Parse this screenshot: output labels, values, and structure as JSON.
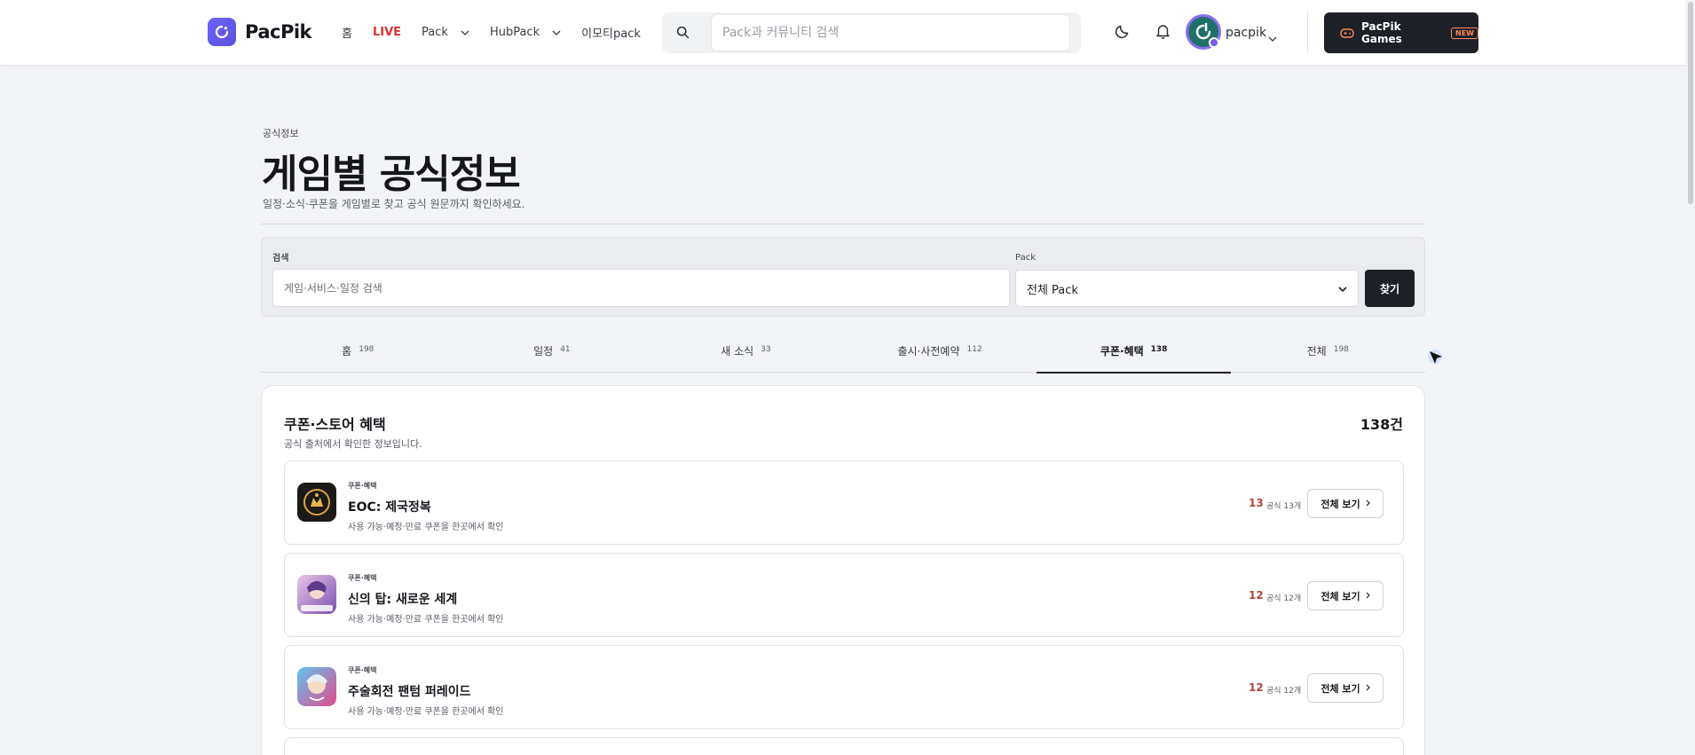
{
  "header": {
    "logo_text": "PacPik",
    "nav": [
      {
        "label": "홈"
      },
      {
        "label": "LIVE"
      },
      {
        "label": "Pack"
      },
      {
        "label": "HubPack"
      },
      {
        "label": "이모티pack"
      }
    ],
    "search_placeholder": "Pack과 커뮤니티 검색",
    "user_name": "pacpik",
    "games_button": "PacPik Games",
    "new_badge": "NEW"
  },
  "page": {
    "eyebrow": "공식정보",
    "title": "게임별 공식정보",
    "subtitle": "일정·소식·쿠폰을 게임별로 찾고 공식 원문까지 확인하세요."
  },
  "filter": {
    "search_label": "검색",
    "search_placeholder": "게임·서비스·일정 검색",
    "pack_label": "Pack",
    "pack_selected": "전체 Pack",
    "submit_label": "찾기"
  },
  "tabs": [
    {
      "label": "홈",
      "count": "198"
    },
    {
      "label": "일정",
      "count": "41"
    },
    {
      "label": "새 소식",
      "count": "33"
    },
    {
      "label": "출시·사전예약",
      "count": "112"
    },
    {
      "label": "쿠폰·혜택",
      "count": "138"
    },
    {
      "label": "전체",
      "count": "198"
    }
  ],
  "list": {
    "title": "쿠폰·스토어 혜택",
    "description": "공식 출처에서 확인한 정보입니다.",
    "count": "138건",
    "items": [
      {
        "tag": "쿠폰·혜택",
        "title": "EOC: 제국정복",
        "desc": "사용 가능·예정·만료 쿠폰을 한곳에서 확인",
        "num": "13",
        "sub": "공식 13개",
        "button": "전체 보기",
        "icon": "eoc-game-icon"
      },
      {
        "tag": "쿠폰·혜택",
        "title": "신의 탑: 새로운 세계",
        "desc": "사용 가능·예정·만료 쿠폰을 한곳에서 확인",
        "num": "12",
        "sub": "공식 12개",
        "button": "전체 보기",
        "icon": "tower-of-god-game-icon"
      },
      {
        "tag": "쿠폰·혜택",
        "title": "주술회전 팬텀 퍼레이드",
        "desc": "사용 가능·예정·만료 쿠폰을 한곳에서 확인",
        "num": "12",
        "sub": "공식 12개",
        "button": "전체 보기",
        "icon": "jujutsu-kaisen-game-icon"
      }
    ]
  },
  "colors": {
    "accent": "#6c63ff",
    "live": "#e03131",
    "dark": "#1e2028",
    "count_red": "#b2453c"
  }
}
